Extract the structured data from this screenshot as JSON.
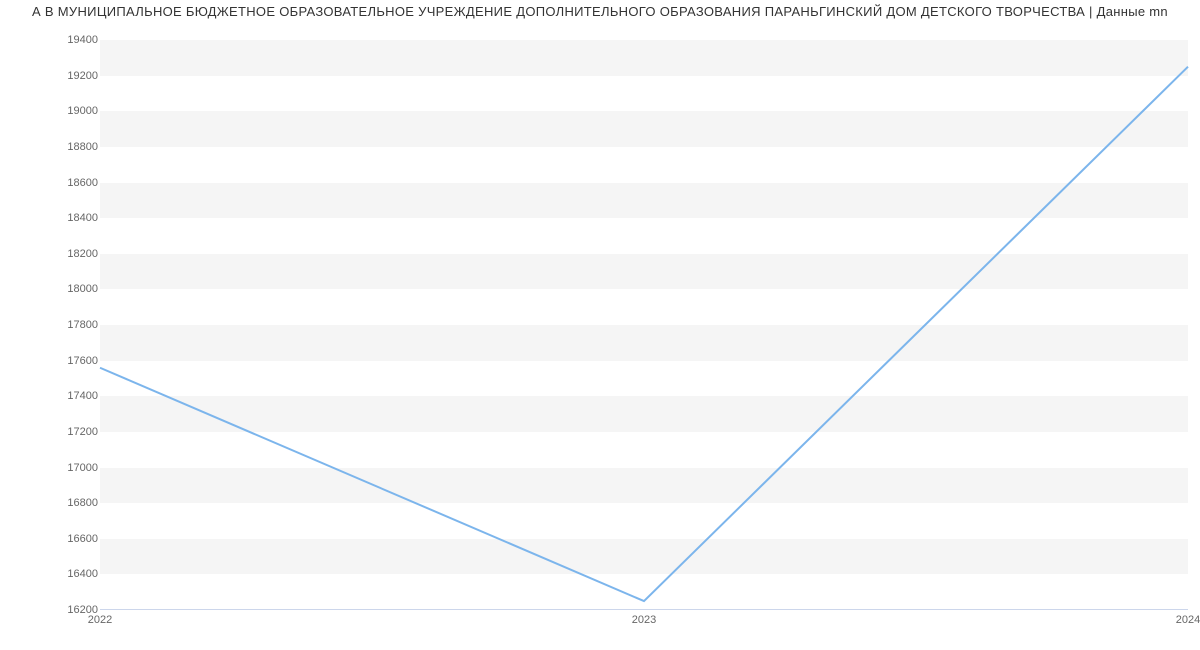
{
  "chart_data": {
    "type": "line",
    "title": "А В МУНИЦИПАЛЬНОЕ БЮДЖЕТНОЕ ОБРАЗОВАТЕЛЬНОЕ УЧРЕЖДЕНИЕ ДОПОЛНИТЕЛЬНОГО ОБРАЗОВАНИЯ  ПАРАНЬГИНСКИЙ ДОМ ДЕТСКОГО ТВОРЧЕСТВА | Данные mn",
    "x": [
      2022,
      2023,
      2024
    ],
    "values": [
      17560,
      16250,
      19250
    ],
    "xlabel": "",
    "ylabel": "",
    "ylim": [
      16200,
      19400
    ],
    "y_ticks": [
      16200,
      16400,
      16600,
      16800,
      17000,
      17200,
      17400,
      17600,
      17800,
      18000,
      18200,
      18400,
      18600,
      18800,
      19000,
      19200,
      19400
    ],
    "x_ticks": [
      2022,
      2023,
      2024
    ],
    "line_color": "#7cb5ec"
  }
}
